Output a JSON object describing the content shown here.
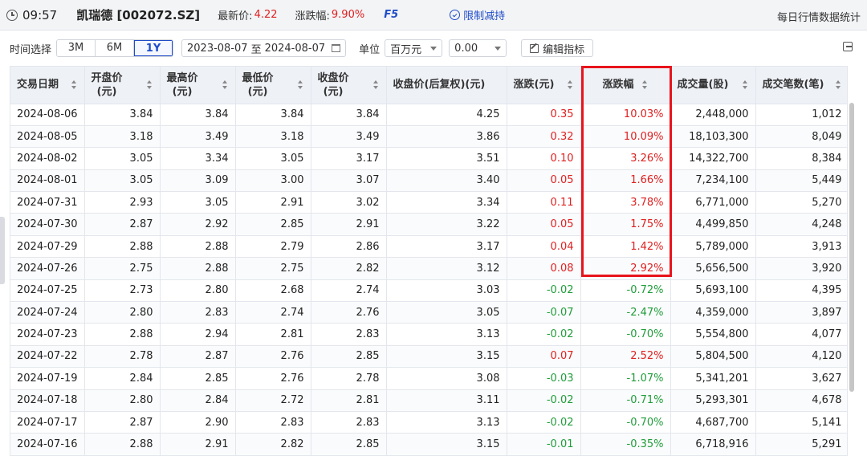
{
  "header": {
    "time": "09:57",
    "stock": "凯瑞德 [002072.SZ]",
    "latest_label": "最新价:",
    "latest_value": "4.22",
    "change_label": "涨跌幅:",
    "change_value": "9.90%",
    "f5": "F5",
    "limit_label": "限制减持",
    "right_title": "每日行情数据统计"
  },
  "toolbar": {
    "time_label": "时间选择",
    "ranges": [
      "3M",
      "6M",
      "1Y"
    ],
    "active_range": "1Y",
    "date_start": "2023-08-07",
    "date_sep": "至",
    "date_end": "2024-08-07",
    "unit_label": "单位",
    "unit_value": "百万元",
    "precision_value": "0.00",
    "edit_label": "编辑指标"
  },
  "table": {
    "columns": [
      {
        "line1": "交易日期",
        "line2": ""
      },
      {
        "line1": "开盘价",
        "line2": "(元)"
      },
      {
        "line1": "最高价",
        "line2": "(元)"
      },
      {
        "line1": "最低价",
        "line2": "(元)"
      },
      {
        "line1": "收盘价",
        "line2": "(元)"
      },
      {
        "line1": "收盘价(后复权)(元)",
        "line2": ""
      },
      {
        "line1": "涨跌(元)",
        "line2": ""
      },
      {
        "line1": "涨跌幅",
        "line2": ""
      },
      {
        "line1": "成交量(股)",
        "line2": ""
      },
      {
        "line1": "成交笔数(笔)",
        "line2": ""
      }
    ],
    "rows": [
      [
        "2024-08-06",
        "3.84",
        "3.84",
        "3.84",
        "3.84",
        "4.25",
        "0.35",
        "10.03%",
        "2,448,000",
        "1,012"
      ],
      [
        "2024-08-05",
        "3.18",
        "3.49",
        "3.18",
        "3.49",
        "3.86",
        "0.32",
        "10.09%",
        "18,103,300",
        "8,049"
      ],
      [
        "2024-08-02",
        "3.05",
        "3.34",
        "3.05",
        "3.17",
        "3.51",
        "0.10",
        "3.26%",
        "14,322,700",
        "8,384"
      ],
      [
        "2024-08-01",
        "3.05",
        "3.09",
        "3.00",
        "3.07",
        "3.40",
        "0.05",
        "1.66%",
        "7,234,100",
        "5,449"
      ],
      [
        "2024-07-31",
        "2.93",
        "3.05",
        "2.91",
        "3.02",
        "3.34",
        "0.11",
        "3.78%",
        "6,771,000",
        "5,270"
      ],
      [
        "2024-07-30",
        "2.87",
        "2.92",
        "2.85",
        "2.91",
        "3.22",
        "0.05",
        "1.75%",
        "4,499,850",
        "4,248"
      ],
      [
        "2024-07-29",
        "2.88",
        "2.88",
        "2.79",
        "2.86",
        "3.17",
        "0.04",
        "1.42%",
        "5,789,000",
        "3,913"
      ],
      [
        "2024-07-26",
        "2.75",
        "2.88",
        "2.75",
        "2.82",
        "3.12",
        "0.08",
        "2.92%",
        "5,656,500",
        "3,920"
      ],
      [
        "2024-07-25",
        "2.73",
        "2.80",
        "2.68",
        "2.74",
        "3.03",
        "-0.02",
        "-0.72%",
        "5,693,100",
        "4,395"
      ],
      [
        "2024-07-24",
        "2.80",
        "2.83",
        "2.74",
        "2.76",
        "3.05",
        "-0.07",
        "-2.47%",
        "4,359,000",
        "3,897"
      ],
      [
        "2024-07-23",
        "2.88",
        "2.94",
        "2.81",
        "2.83",
        "3.13",
        "-0.02",
        "-0.70%",
        "5,554,800",
        "4,077"
      ],
      [
        "2024-07-22",
        "2.78",
        "2.87",
        "2.76",
        "2.85",
        "3.15",
        "0.07",
        "2.52%",
        "5,804,500",
        "4,120"
      ],
      [
        "2024-07-19",
        "2.84",
        "2.85",
        "2.76",
        "2.78",
        "3.08",
        "-0.03",
        "-1.07%",
        "5,341,201",
        "3,627"
      ],
      [
        "2024-07-18",
        "2.80",
        "2.84",
        "2.72",
        "2.81",
        "3.11",
        "-0.02",
        "-0.71%",
        "5,293,301",
        "4,678"
      ],
      [
        "2024-07-17",
        "2.87",
        "2.90",
        "2.83",
        "2.83",
        "3.13",
        "-0.02",
        "-0.70%",
        "4,687,700",
        "5,141"
      ],
      [
        "2024-07-16",
        "2.88",
        "2.91",
        "2.82",
        "2.85",
        "3.15",
        "-0.01",
        "-0.35%",
        "6,718,916",
        "5,291"
      ]
    ]
  },
  "colors": {
    "up": "#e02020",
    "down": "#1f9d3a",
    "accent": "#1f4bc8",
    "highlight": "#e8141c"
  }
}
